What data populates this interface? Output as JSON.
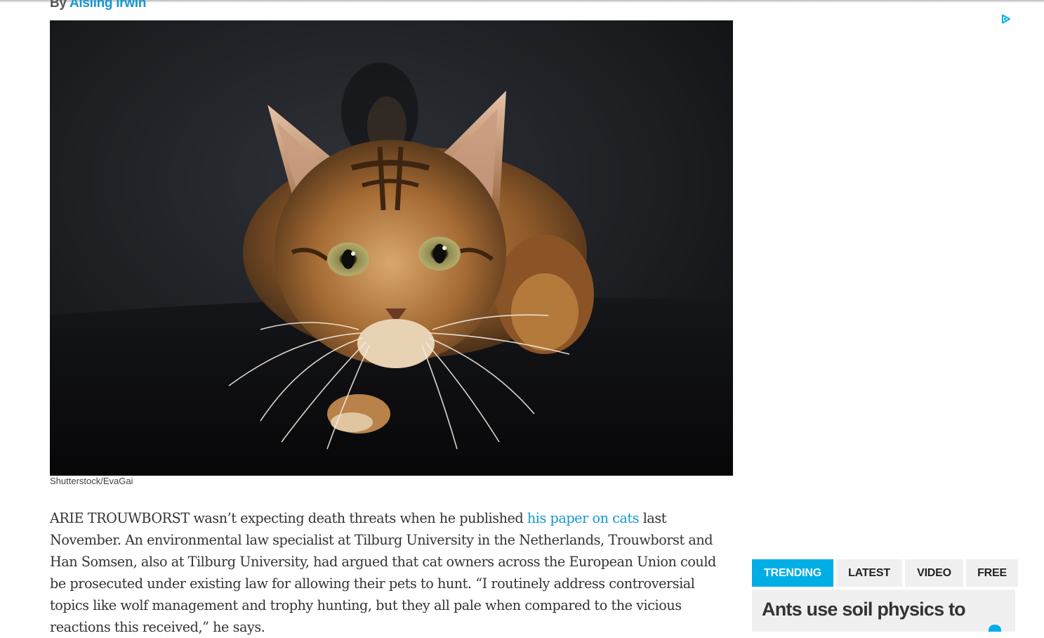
{
  "article": {
    "byline_prefix": "By",
    "author": "Aisling Irwin",
    "image_credit": "Shutterstock/EvaGai",
    "paragraph_start": "ARIE TROUWBORST wasn’t expecting death threats when he published",
    "paragraph_link": "his paper on cats",
    "paragraph_rest": "last November. An environmental law specialist at Tilburg University in the Netherlands, Trouwborst and Han Somsen, also at Tilburg University, had argued that cat owners across the European Union could be prosecuted under existing law for allowing their pets to hunt. “I routinely address controversial topics like wolf management and trophy hunting, but they all pale when compared to the vicious reactions this received,” he says."
  },
  "sidebar": {
    "tabs": [
      {
        "label": "TRENDING",
        "active": true
      },
      {
        "label": "LATEST",
        "active": false
      },
      {
        "label": "VIDEO",
        "active": false
      },
      {
        "label": "FREE",
        "active": false
      }
    ],
    "trending_headline": "Ants use soil physics to"
  },
  "colors": {
    "accent": "#00aee6",
    "link": "#1497d0"
  },
  "icons": {
    "ad_choices": "adchoices-icon"
  }
}
